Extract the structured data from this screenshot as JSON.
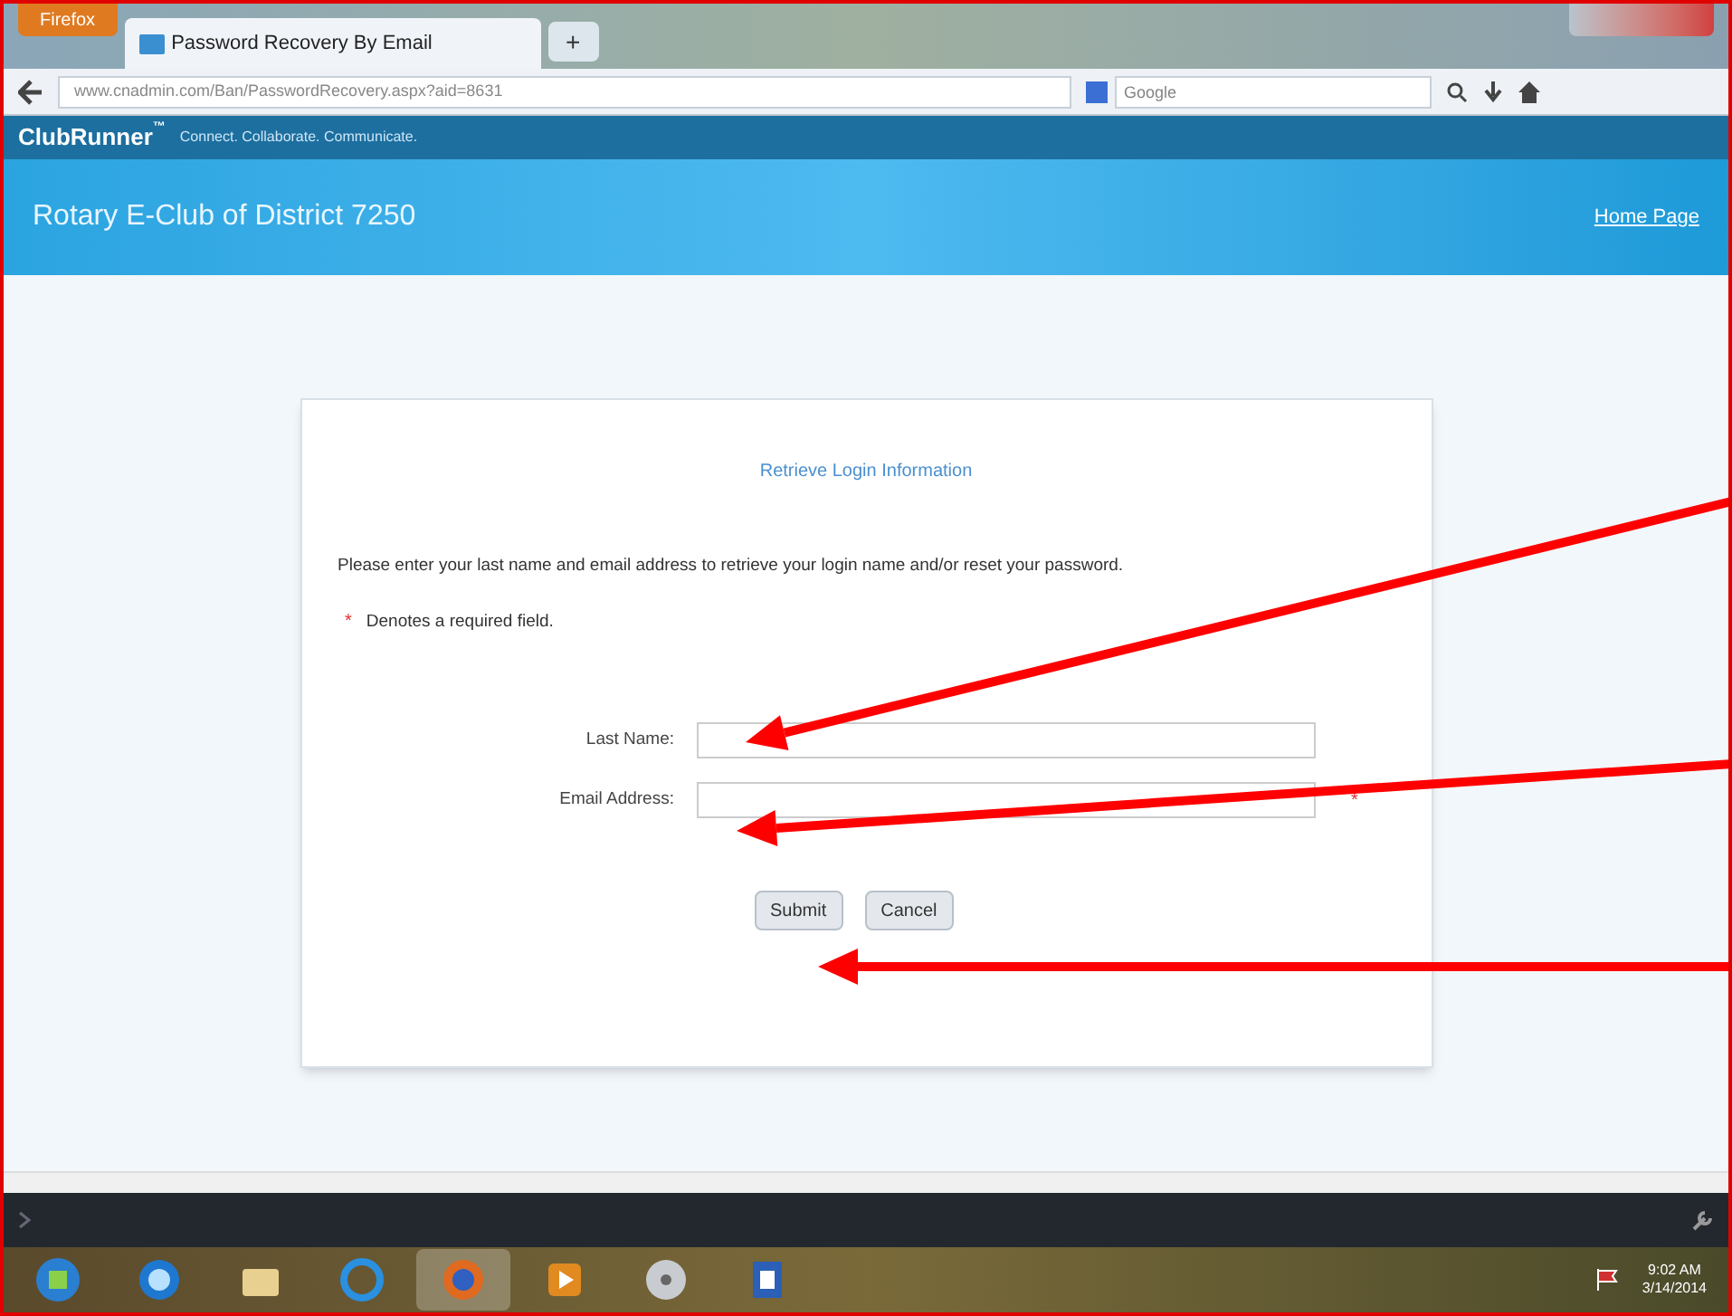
{
  "browser": {
    "menu_button": "Firefox",
    "tabs": [
      {
        "title": "Password Recovery By Email",
        "selected": true
      }
    ],
    "new_tab": "+",
    "address": "www.cnadmin.com/Ban/PasswordRecovery.aspx?aid=8631",
    "search_placeholder": "Google"
  },
  "site": {
    "brand": "ClubRunner",
    "trademark": "™",
    "tagline": "Connect. Collaborate. Communicate.",
    "club_name": "Rotary E-Club of District 7250",
    "home_link": "Home Page"
  },
  "form": {
    "title": "Retrieve Login Information",
    "intro": "Please enter your last name and email address to retrieve your login name and/or reset your password.",
    "required_mark": "*",
    "required_note": "Denotes a required field.",
    "fields": [
      {
        "label": "Last Name:",
        "required": false
      },
      {
        "label": "Email Address:",
        "required": true
      }
    ],
    "buttons": [
      "Submit",
      "Cancel"
    ]
  },
  "taskbar": {
    "time": "9:02 AM",
    "date": "3/14/2014"
  }
}
